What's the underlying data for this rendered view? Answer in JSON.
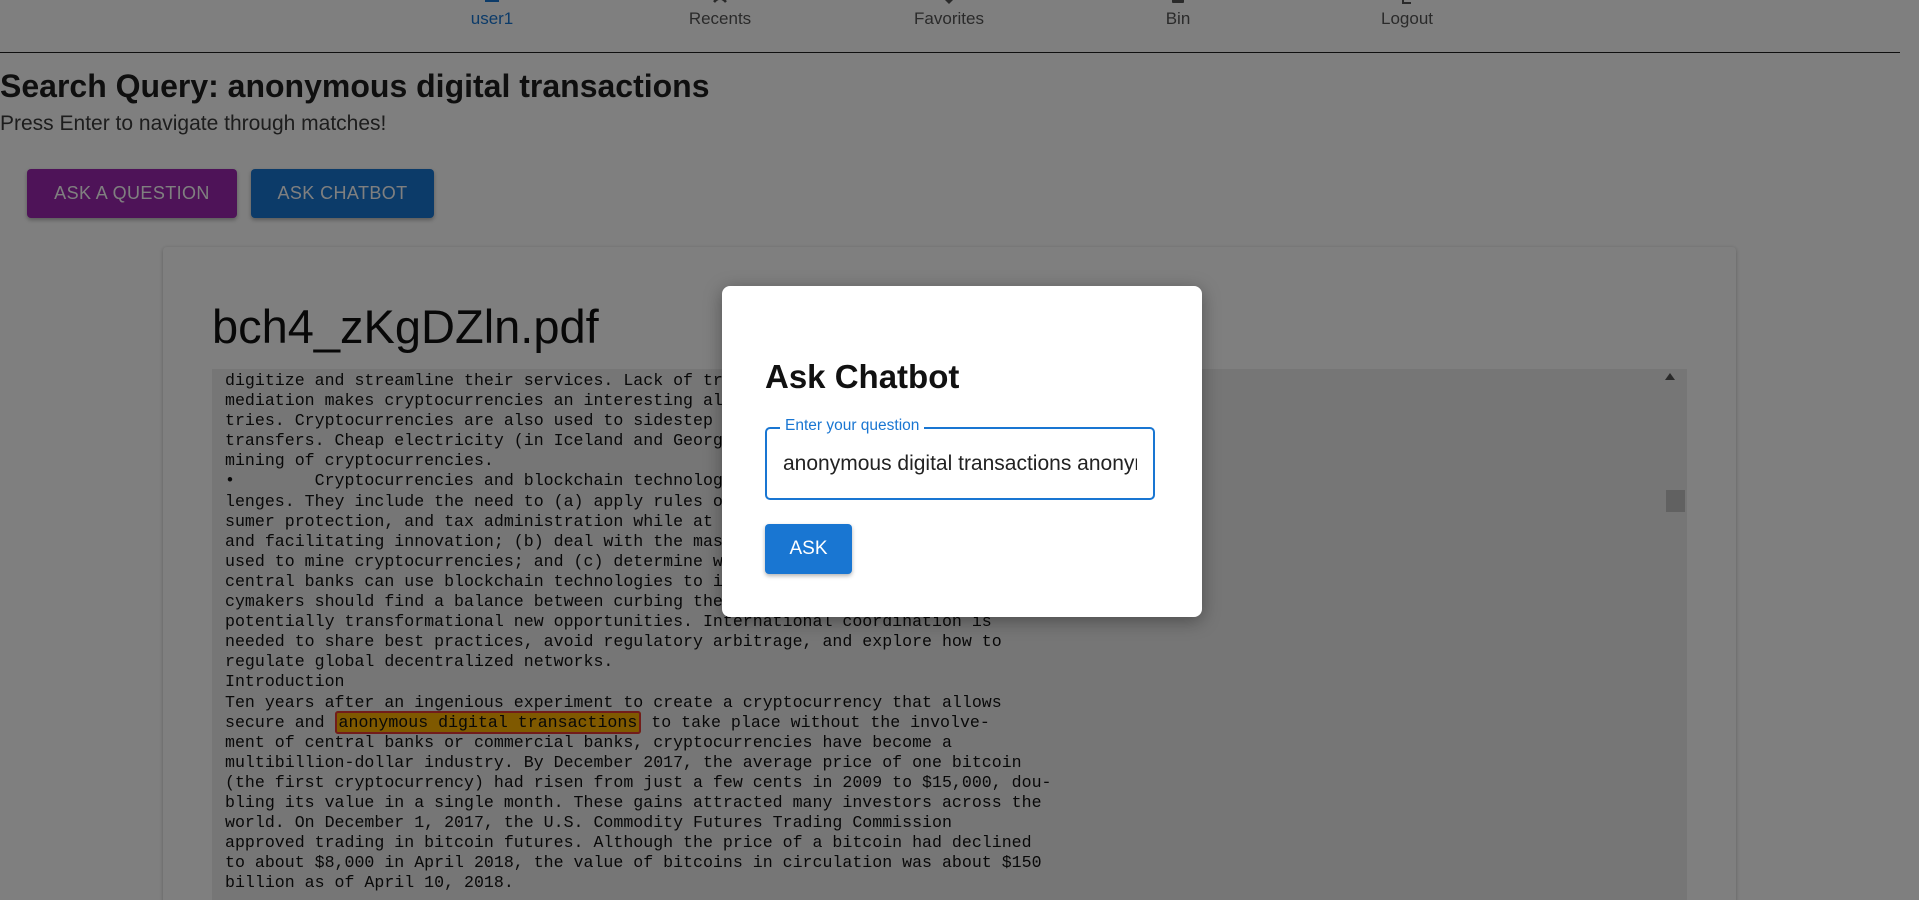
{
  "nav": {
    "items": [
      {
        "label": "user1",
        "icon": "user-icon",
        "active": true
      },
      {
        "label": "Recents",
        "icon": "clock-icon",
        "active": false
      },
      {
        "label": "Favorites",
        "icon": "heart-icon",
        "active": false
      },
      {
        "label": "Bin",
        "icon": "trash-icon",
        "active": false
      },
      {
        "label": "Logout",
        "icon": "logout-icon",
        "active": false
      }
    ]
  },
  "search": {
    "title": "Search Query: anonymous digital transactions",
    "hint": "Press Enter to navigate through matches!"
  },
  "actions": {
    "ask_question": "ASK A QUESTION",
    "ask_chatbot": "ASK CHATBOT"
  },
  "document": {
    "title": "bch4_zKgDZln.pdf",
    "highlight_match": "anonymous digital transactions",
    "lines": [
      "digitize and streamline their services. Lack of tru",
      "mediation makes cryptocurrencies an interesting alt",
      "tries. Cryptocurrencies are also used to sidestep o",
      "transfers. Cheap electricity (in Iceland and Georgi",
      "mining of cryptocurrencies.",
      "•        Cryptocurrencies and blockchain technologi",
      "lenges. They include the need to (a) apply rules of",
      "sumer protection, and tax administration while at t",
      "and facilitating innovation; (b) deal with the mass",
      "used to mine cryptocurrencies; and (c) determine wh",
      "central banks can use blockchain technologies to im",
      "cymakers should find a balance between curbing the",
      "potentially transformational new opportunities. International coordination is",
      "needed to share best practices, avoid regulatory arbitrage, and explore how to",
      "regulate global decentralized networks.",
      "Introduction",
      "Ten years after an ingenious experiment to create a cryptocurrency that allows",
      {
        "before": "secure and ",
        "match": "anonymous digital transactions",
        "after": " to take place without the involve-"
      },
      "ment of central banks or commercial banks, cryptocurrencies have become a",
      "multibillion-dollar industry. By December 2017, the average price of one bitcoin",
      "(the first cryptocurrency) had risen from just a few cents in 2009 to $15,000, dou-",
      "bling its value in a single month. These gains attracted many investors across the",
      "world. On December 1, 2017, the U.S. Commodity Futures Trading Commission",
      "approved trading in bitcoin futures. Although the price of a bitcoin had declined",
      "to about $8,000 in April 2018, the value of bitcoins in circulation was about $150",
      "billion as of April 10, 2018."
    ]
  },
  "modal": {
    "title": "Ask Chatbot",
    "field_label": "Enter your question",
    "field_value": "anonymous digital transactions anonymous digital transactions",
    "ask_label": "ASK"
  },
  "colors": {
    "primary": "#1976d2",
    "purple": "#9c27b0",
    "highlight": "#ffb300",
    "highlight_border": "#e53935"
  }
}
